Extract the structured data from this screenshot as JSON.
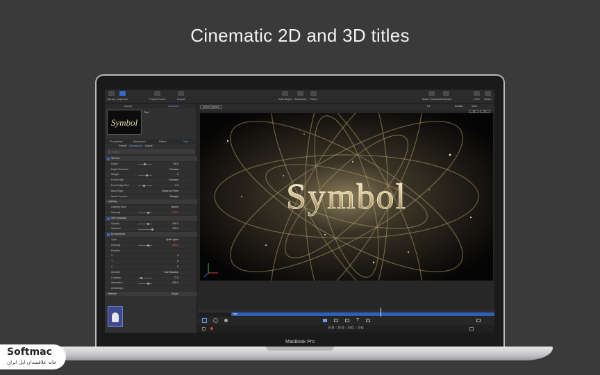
{
  "headline": "Cinematic 2D and 3D titles",
  "laptop": {
    "label": "MacBook Pro"
  },
  "toolbar": {
    "left": [
      "Library",
      "Inspector",
      "Project Pane",
      "Import"
    ],
    "center": [
      "Add Object",
      "Behaviors",
      "Filters"
    ],
    "right": [
      "Make Particles",
      "Replicate",
      "HUD",
      "Share"
    ]
  },
  "library_tabs": [
    "Library",
    "Inspector"
  ],
  "preview": {
    "text": "Symbol",
    "label": "Text"
  },
  "inspector_tabs": [
    "Properties",
    "Behaviors",
    "Filters",
    "Text"
  ],
  "text_subtabs": [
    "Format",
    "Appearance",
    "Layout"
  ],
  "font_field": "Al Tinted",
  "canvas": {
    "camera": "Active Camera",
    "zoom_menu": "Fit",
    "render_menu": "Render",
    "view_menu": "View",
    "title_text": "Symbol"
  },
  "properties": [
    {
      "type": "section",
      "label": "3D Text",
      "checked": true
    },
    {
      "label": "Depth",
      "value": "80.0",
      "slider": 0.45
    },
    {
      "label": "Depth Direction",
      "value": "Forward"
    },
    {
      "label": "Weight",
      "value": "0",
      "slider": 0.6
    },
    {
      "label": "Front Edge",
      "value": "Concave"
    },
    {
      "label": "Front Edge Size",
      "value": "0.3",
      "slider": 0.4
    },
    {
      "label": "Back Edge",
      "value": "Same As Front"
    },
    {
      "label": "Inside Corners",
      "value": "Straight"
    },
    {
      "type": "header",
      "label": "Lighting"
    },
    {
      "label": "Lighting Style",
      "value": "Above"
    },
    {
      "label": "Intensity",
      "value": "100.0",
      "red": true,
      "slider": 0.7
    },
    {
      "type": "section",
      "label": "Self Shadows",
      "checked": true
    },
    {
      "label": "Opacity",
      "value": "100.0",
      "slider": 0.7
    },
    {
      "label": "Softness",
      "value": "100.0",
      "slider": 1.0
    },
    {
      "type": "section",
      "label": "Environment",
      "checked": true
    },
    {
      "label": "Type",
      "value": "Spot Lights"
    },
    {
      "label": "Intensity",
      "value": "200.0",
      "red": true,
      "slider": 0.7
    },
    {
      "label": "Rotation",
      "value": ""
    },
    {
      "label": "X",
      "value": "0"
    },
    {
      "label": "Y",
      "value": "0"
    },
    {
      "label": "Z",
      "value": "0"
    },
    {
      "label": "Animate",
      "value": "Use Rotation"
    },
    {
      "label": "Contrast",
      "value": "77.0",
      "slider": 0.2
    },
    {
      "label": "Saturation",
      "value": "100.0",
      "slider": 0.7
    },
    {
      "label": "Anisotropic",
      "value": ""
    },
    {
      "type": "header",
      "label": "Material",
      "value": "Single"
    }
  ],
  "timeline": {
    "layer_label": "Text"
  },
  "transport": {
    "timecode": "00:00:06:06"
  },
  "watermark": {
    "title": "Softmac",
    "subtitle": "خانه علاقمندان اپل ایران"
  }
}
